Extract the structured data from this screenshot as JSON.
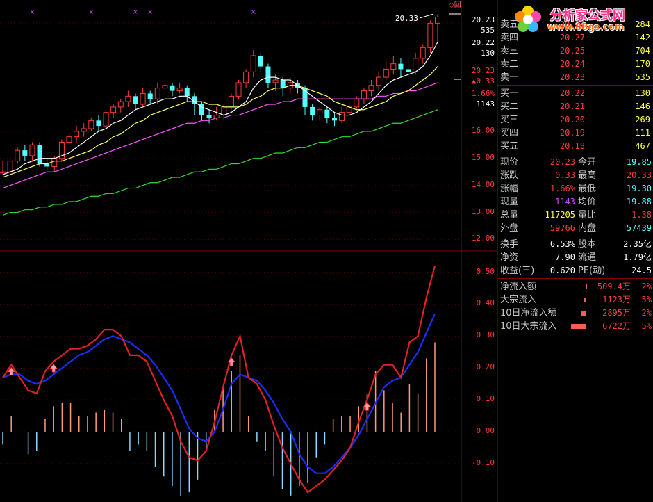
{
  "colors": {
    "up": "#ff3c3c",
    "down": "#54ffff",
    "ma5": "#ffffff",
    "ma10": "#ffff66",
    "ma20": "#ff55ff",
    "ma60": "#33dd33",
    "grid": "#8a0000",
    "label": "#c8c8c8",
    "value_red": "#ff3c3c",
    "value_green": "#54ffff",
    "value_yellow": "#ffff44",
    "value_purple": "#cc44ff"
  },
  "header": {
    "ticker_partial": "20.33"
  },
  "logo": {
    "site_name": "分析家公式网",
    "url": "www.88gs.com",
    "icon": "flower-logo-icon"
  },
  "price_axis": {
    "ticks": [
      "16.00",
      "15.00",
      "14.00",
      "13.00",
      "12.00"
    ],
    "right_labels": [
      {
        "text": "20.23",
        "color": "#ffffff"
      },
      {
        "text": "535",
        "color": "#ffffff"
      },
      {
        "text": "20.22",
        "color": "#ffffff"
      },
      {
        "text": "130",
        "color": "#ffffff"
      },
      {
        "text": "20.23",
        "color": "#ff3c3c"
      },
      {
        "text": "▲0.33",
        "color": "#ff3c3c"
      },
      {
        "text": "1.66%",
        "color": "#ff3c3c"
      },
      {
        "text": "1143",
        "color": "#ffffff"
      }
    ]
  },
  "indicator_axis": {
    "ticks": [
      "0.50",
      "0.40",
      "0.30",
      "0.20",
      "0.10",
      "0.00",
      "-0.10"
    ]
  },
  "order_book": {
    "sell": [
      {
        "label": "卖五",
        "price": "20.28",
        "vol": "284"
      },
      {
        "label": "卖四",
        "price": "20.27",
        "vol": "142"
      },
      {
        "label": "卖三",
        "price": "20.25",
        "vol": "704"
      },
      {
        "label": "卖二",
        "price": "20.24",
        "vol": "170"
      },
      {
        "label": "卖一",
        "price": "20.23",
        "vol": "535"
      }
    ],
    "buy": [
      {
        "label": "买一",
        "price": "20.22",
        "vol": "130"
      },
      {
        "label": "买二",
        "price": "20.21",
        "vol": "146"
      },
      {
        "label": "买三",
        "price": "20.20",
        "vol": "269"
      },
      {
        "label": "买四",
        "price": "20.19",
        "vol": "111"
      },
      {
        "label": "买五",
        "price": "20.18",
        "vol": "467"
      }
    ]
  },
  "stats": [
    {
      "l1": "现价",
      "v1": "20.23",
      "c1": "#ff3c3c",
      "l2": "今开",
      "v2": "19.85",
      "c2": "#54ffff"
    },
    {
      "l1": "涨跌",
      "v1": "0.33",
      "c1": "#ff3c3c",
      "l2": "最高",
      "v2": "20.33",
      "c2": "#ff3c3c"
    },
    {
      "l1": "涨幅",
      "v1": "1.66%",
      "c1": "#ff3c3c",
      "l2": "最低",
      "v2": "19.30",
      "c2": "#54ffff"
    },
    {
      "l1": "现量",
      "v1": "1143",
      "c1": "#cc44ff",
      "l2": "均价",
      "v2": "19.88",
      "c2": "#54ffff"
    },
    {
      "l1": "总量",
      "v1": "117205",
      "c1": "#ffff44",
      "l2": "量比",
      "v2": "1.38",
      "c2": "#ff3c3c"
    },
    {
      "l1": "外盘",
      "v1": "59766",
      "c1": "#ff3c3c",
      "l2": "内盘",
      "v2": "57439",
      "c2": "#54ffff"
    }
  ],
  "fundamentals": [
    {
      "l1": "换手",
      "v1": "6.53%",
      "l2": "股本",
      "v2": "2.35亿"
    },
    {
      "l1": "净资",
      "v1": "7.90",
      "l2": "流通",
      "v2": "1.79亿"
    },
    {
      "l1": "收益(三)",
      "v1": "0.620",
      "l2": "PE(动)",
      "v2": "24.5"
    }
  ],
  "flows": [
    {
      "label": "净流入额",
      "value": "509.4万",
      "pct": "2%",
      "bar": 0.05
    },
    {
      "label": "大宗流入",
      "value": "1123万",
      "pct": "5%",
      "bar": 0.1
    },
    {
      "label": "10日净流入额",
      "value": "2895万",
      "pct": "2%",
      "bar": 0.3
    },
    {
      "label": "10日大宗流入",
      "value": "6722万",
      "pct": "5%",
      "bar": 0.85
    }
  ],
  "chart_data": [
    {
      "type": "candlestick",
      "ylim": [
        11.6,
        20.6
      ],
      "candles": [
        [
          14.5,
          14.5,
          14.9,
          14.4
        ],
        [
          14.5,
          14.9,
          15.0,
          14.4
        ],
        [
          14.9,
          15.3,
          15.4,
          14.8
        ],
        [
          15.3,
          15.1,
          15.5,
          14.9
        ],
        [
          15.1,
          15.5,
          15.6,
          14.9
        ],
        [
          15.5,
          14.8,
          15.6,
          14.7
        ],
        [
          14.8,
          14.7,
          15.0,
          14.6
        ],
        [
          14.7,
          15.0,
          15.1,
          14.5
        ],
        [
          15.0,
          15.6,
          15.7,
          14.9
        ],
        [
          15.6,
          15.8,
          15.9,
          15.4
        ],
        [
          15.8,
          16.0,
          16.2,
          15.6
        ],
        [
          16.0,
          16.1,
          16.3,
          15.8
        ],
        [
          16.1,
          16.4,
          16.5,
          16.0
        ],
        [
          16.4,
          16.2,
          16.6,
          16.0
        ],
        [
          16.2,
          16.7,
          16.8,
          16.1
        ],
        [
          16.7,
          16.9,
          17.0,
          16.5
        ],
        [
          16.9,
          17.1,
          17.2,
          16.7
        ],
        [
          17.1,
          17.3,
          17.5,
          16.9
        ],
        [
          17.3,
          17.0,
          17.4,
          16.8
        ],
        [
          17.0,
          17.4,
          17.6,
          16.9
        ],
        [
          17.4,
          17.2,
          17.5,
          17.0
        ],
        [
          17.2,
          17.6,
          17.8,
          17.0
        ],
        [
          17.6,
          17.7,
          17.9,
          17.4
        ],
        [
          17.7,
          17.5,
          17.8,
          17.3
        ],
        [
          17.5,
          17.6,
          17.8,
          17.4
        ],
        [
          17.6,
          17.3,
          17.7,
          17.1
        ],
        [
          17.3,
          17.0,
          17.4,
          16.6
        ],
        [
          17.0,
          16.6,
          17.1,
          16.4
        ],
        [
          16.6,
          16.5,
          16.8,
          16.3
        ],
        [
          16.5,
          16.6,
          16.9,
          16.4
        ],
        [
          16.6,
          16.9,
          17.0,
          16.4
        ],
        [
          16.9,
          17.3,
          17.4,
          16.8
        ],
        [
          17.3,
          17.8,
          17.9,
          17.2
        ],
        [
          17.8,
          18.2,
          18.3,
          17.6
        ],
        [
          18.2,
          18.8,
          19.0,
          18.0
        ],
        [
          18.8,
          18.4,
          18.9,
          18.2
        ],
        [
          18.4,
          17.8,
          18.5,
          17.6
        ],
        [
          17.8,
          17.9,
          18.1,
          17.5
        ],
        [
          17.9,
          17.6,
          18.0,
          17.3
        ],
        [
          17.6,
          17.8,
          18.0,
          17.4
        ],
        [
          17.8,
          17.6,
          17.9,
          17.4
        ],
        [
          17.6,
          16.9,
          17.7,
          16.6
        ],
        [
          16.9,
          16.6,
          17.0,
          16.4
        ],
        [
          16.6,
          16.8,
          16.9,
          16.4
        ],
        [
          16.8,
          16.5,
          16.9,
          16.3
        ],
        [
          16.5,
          16.4,
          16.7,
          16.2
        ],
        [
          16.4,
          16.7,
          16.9,
          16.3
        ],
        [
          16.7,
          16.9,
          17.1,
          16.6
        ],
        [
          16.9,
          17.2,
          17.3,
          16.8
        ],
        [
          17.2,
          17.5,
          17.6,
          17.0
        ],
        [
          17.5,
          17.7,
          17.9,
          17.3
        ],
        [
          17.7,
          18.0,
          18.2,
          17.5
        ],
        [
          18.0,
          18.3,
          18.6,
          17.9
        ],
        [
          18.3,
          18.5,
          18.8,
          18.1
        ],
        [
          18.5,
          18.3,
          18.7,
          18.0
        ],
        [
          18.3,
          18.2,
          18.8,
          18.0
        ],
        [
          18.2,
          18.7,
          18.9,
          18.1
        ],
        [
          18.7,
          19.1,
          19.2,
          18.5
        ],
        [
          19.1,
          20.0,
          20.1,
          18.9
        ],
        [
          20.0,
          20.23,
          20.33,
          19.3
        ]
      ],
      "ma5": [
        14.4,
        14.5,
        14.6,
        14.8,
        14.9,
        15.0,
        15.0,
        15.0,
        15.1,
        15.2,
        15.4,
        15.6,
        15.8,
        16.0,
        16.1,
        16.3,
        16.4,
        16.6,
        16.8,
        16.9,
        17.0,
        17.1,
        17.2,
        17.2,
        17.3,
        17.3,
        17.1,
        16.9,
        16.8,
        16.7,
        16.6,
        16.7,
        16.9,
        17.1,
        17.6,
        17.9,
        18.0,
        18.0,
        17.9,
        17.9,
        17.7,
        17.5,
        17.3,
        17.1,
        16.9,
        16.7,
        16.6,
        16.6,
        16.7,
        16.9,
        17.1,
        17.4,
        17.7,
        17.9,
        18.0,
        18.1,
        18.2,
        18.4,
        18.8,
        19.3
      ],
      "ma10": [
        14.3,
        14.4,
        14.5,
        14.6,
        14.7,
        14.8,
        14.8,
        14.9,
        14.9,
        15.0,
        15.1,
        15.2,
        15.3,
        15.5,
        15.6,
        15.8,
        15.9,
        16.1,
        16.3,
        16.4,
        16.6,
        16.7,
        16.8,
        16.9,
        17.0,
        17.1,
        17.1,
        17.1,
        17.0,
        17.0,
        16.9,
        16.9,
        16.9,
        17.0,
        17.2,
        17.3,
        17.5,
        17.6,
        17.6,
        17.7,
        17.7,
        17.6,
        17.5,
        17.4,
        17.3,
        17.1,
        17.0,
        16.9,
        16.8,
        16.8,
        16.9,
        17.0,
        17.1,
        17.3,
        17.4,
        17.5,
        17.7,
        17.9,
        18.1,
        18.4
      ],
      "ma20": [
        13.9,
        14.0,
        14.1,
        14.2,
        14.3,
        14.4,
        14.5,
        14.5,
        14.6,
        14.7,
        14.8,
        14.9,
        15.0,
        15.1,
        15.2,
        15.3,
        15.4,
        15.5,
        15.6,
        15.7,
        15.8,
        15.9,
        16.0,
        16.1,
        16.2,
        16.3,
        16.3,
        16.4,
        16.4,
        16.5,
        16.5,
        16.6,
        16.6,
        16.7,
        16.8,
        16.9,
        17.0,
        17.0,
        17.1,
        17.1,
        17.2,
        17.2,
        17.2,
        17.2,
        17.2,
        17.2,
        17.2,
        17.2,
        17.2,
        17.2,
        17.2,
        17.3,
        17.3,
        17.4,
        17.4,
        17.5,
        17.5,
        17.6,
        17.7,
        17.8
      ],
      "ma60": [
        12.9,
        13.0,
        13.0,
        13.1,
        13.1,
        13.2,
        13.2,
        13.3,
        13.3,
        13.4,
        13.4,
        13.5,
        13.6,
        13.6,
        13.7,
        13.7,
        13.8,
        13.9,
        13.9,
        14.0,
        14.1,
        14.1,
        14.2,
        14.3,
        14.3,
        14.4,
        14.5,
        14.5,
        14.6,
        14.6,
        14.7,
        14.8,
        14.8,
        14.9,
        15.0,
        15.0,
        15.1,
        15.2,
        15.2,
        15.3,
        15.4,
        15.4,
        15.5,
        15.6,
        15.6,
        15.7,
        15.8,
        15.8,
        15.9,
        16.0,
        16.0,
        16.1,
        16.2,
        16.3,
        16.3,
        16.4,
        16.5,
        16.6,
        16.7,
        16.8
      ],
      "markers_top": [
        4,
        12,
        18,
        20,
        34
      ]
    },
    {
      "type": "line",
      "ylim": [
        -0.22,
        0.56
      ],
      "fast": [
        0.17,
        0.21,
        0.17,
        0.13,
        0.12,
        0.19,
        0.22,
        0.24,
        0.26,
        0.26,
        0.27,
        0.29,
        0.32,
        0.32,
        0.3,
        0.24,
        0.24,
        0.22,
        0.16,
        0.1,
        0.05,
        -0.03,
        -0.08,
        -0.09,
        -0.06,
        0.03,
        0.14,
        0.24,
        0.3,
        0.17,
        0.15,
        0.1,
        0.02,
        -0.05,
        -0.1,
        -0.15,
        -0.19,
        -0.17,
        -0.15,
        -0.12,
        -0.09,
        -0.05,
        0.03,
        0.1,
        0.18,
        0.21,
        0.21,
        0.17,
        0.28,
        0.3,
        0.42,
        0.52
      ],
      "slow": [
        0.17,
        0.18,
        0.18,
        0.16,
        0.15,
        0.16,
        0.18,
        0.2,
        0.22,
        0.24,
        0.25,
        0.27,
        0.29,
        0.3,
        0.29,
        0.28,
        0.26,
        0.24,
        0.21,
        0.17,
        0.13,
        0.07,
        0.01,
        -0.02,
        -0.03,
        0.0,
        0.07,
        0.15,
        0.18,
        0.17,
        0.16,
        0.13,
        0.09,
        0.04,
        0.0,
        -0.07,
        -0.11,
        -0.13,
        -0.13,
        -0.11,
        -0.08,
        -0.05,
        -0.01,
        0.04,
        0.09,
        0.14,
        0.16,
        0.17,
        0.21,
        0.25,
        0.31,
        0.37
      ],
      "bars": [
        -0.04,
        0.05,
        0.0,
        -0.07,
        -0.06,
        0.04,
        0.08,
        0.09,
        0.09,
        0.05,
        0.05,
        0.06,
        0.07,
        0.06,
        0.04,
        -0.06,
        -0.04,
        -0.06,
        -0.11,
        -0.14,
        -0.17,
        -0.2,
        -0.19,
        -0.15,
        -0.06,
        0.07,
        0.14,
        0.19,
        0.24,
        0.05,
        -0.03,
        -0.06,
        -0.14,
        -0.18,
        -0.2,
        -0.17,
        -0.16,
        -0.08,
        -0.04,
        0.04,
        0.05,
        0.05,
        0.08,
        0.12,
        0.19,
        0.13,
        0.09,
        0.06,
        0.15,
        0.12,
        0.23,
        0.28
      ],
      "arrows": [
        1,
        6,
        27,
        43
      ]
    }
  ]
}
